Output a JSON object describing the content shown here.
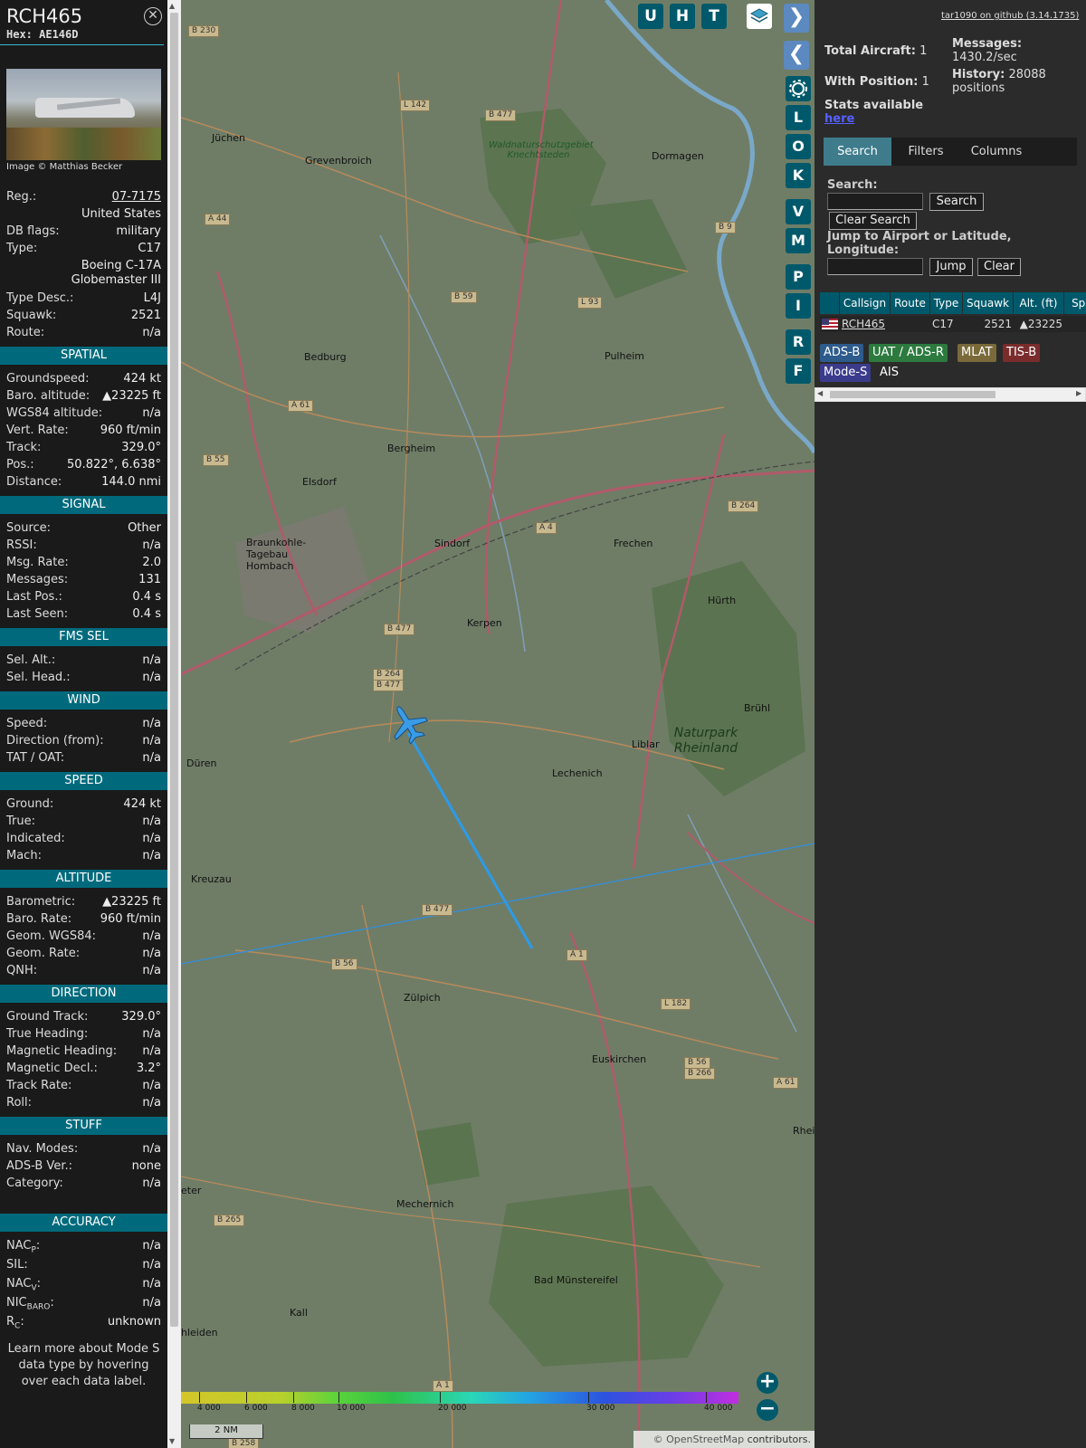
{
  "info": {
    "callsign": "RCH465",
    "hex": "Hex: AE146D",
    "image_credit": "Image © Matthias Becker",
    "top_rows": [
      {
        "k": "Reg.:",
        "v": "07-7175",
        "link": true
      },
      {
        "k": "",
        "v": "United States"
      },
      {
        "k": "DB flags:",
        "v": "military"
      },
      {
        "k": "Type:",
        "v": "C17"
      }
    ],
    "model": "Boeing C-17A Globemaster III",
    "rows2": [
      {
        "k": "Type Desc.:",
        "v": "L4J"
      },
      {
        "k": "Squawk:",
        "v": "2521"
      },
      {
        "k": "Route:",
        "v": "n/a"
      }
    ],
    "sections": [
      {
        "title": "SPATIAL",
        "rows": [
          {
            "k": "Groundspeed:",
            "v": "424 kt"
          },
          {
            "k": "Baro. altitude:",
            "v": "▲23225 ft"
          },
          {
            "k": "WGS84 altitude:",
            "v": "n/a"
          },
          {
            "k": "Vert. Rate:",
            "v": "960 ft/min"
          },
          {
            "k": "Track:",
            "v": "329.0°"
          },
          {
            "k": "Pos.:",
            "v": "50.822°, 6.638°"
          },
          {
            "k": "Distance:",
            "v": "144.0 nmi"
          }
        ]
      },
      {
        "title": "SIGNAL",
        "rows": [
          {
            "k": "Source:",
            "v": "Other"
          },
          {
            "k": "RSSI:",
            "v": "n/a"
          },
          {
            "k": "Msg. Rate:",
            "v": "2.0"
          },
          {
            "k": "Messages:",
            "v": "131"
          },
          {
            "k": "Last Pos.:",
            "v": "0.4 s"
          },
          {
            "k": "Last Seen:",
            "v": "0.4 s"
          }
        ]
      },
      {
        "title": "FMS SEL",
        "rows": [
          {
            "k": "Sel. Alt.:",
            "v": "n/a"
          },
          {
            "k": "Sel. Head.:",
            "v": "n/a"
          }
        ]
      },
      {
        "title": "WIND",
        "rows": [
          {
            "k": "Speed:",
            "v": "n/a"
          },
          {
            "k": "Direction (from):",
            "v": "n/a"
          },
          {
            "k": "TAT / OAT:",
            "v": "n/a"
          }
        ]
      },
      {
        "title": "SPEED",
        "rows": [
          {
            "k": "Ground:",
            "v": "424 kt"
          },
          {
            "k": "True:",
            "v": "n/a"
          },
          {
            "k": "Indicated:",
            "v": "n/a"
          },
          {
            "k": "Mach:",
            "v": "n/a"
          }
        ]
      },
      {
        "title": "ALTITUDE",
        "rows": [
          {
            "k": "Barometric:",
            "v": "▲23225 ft"
          },
          {
            "k": "Baro. Rate:",
            "v": "960 ft/min"
          },
          {
            "k": "Geom. WGS84:",
            "v": "n/a"
          },
          {
            "k": "Geom. Rate:",
            "v": "n/a"
          },
          {
            "k": "QNH:",
            "v": "n/a"
          }
        ]
      },
      {
        "title": "DIRECTION",
        "rows": [
          {
            "k": "Ground Track:",
            "v": "329.0°"
          },
          {
            "k": "True Heading:",
            "v": "n/a"
          },
          {
            "k": "Magnetic Heading:",
            "v": "n/a"
          },
          {
            "k": "Magnetic Decl.:",
            "v": "3.2°"
          },
          {
            "k": "Track Rate:",
            "v": "n/a"
          },
          {
            "k": "Roll:",
            "v": "n/a"
          }
        ]
      },
      {
        "title": "STUFF",
        "rows": [
          {
            "k": "Nav. Modes:",
            "v": "n/a"
          },
          {
            "k": "ADS-B Ver.:",
            "v": "none"
          },
          {
            "k": "Category:",
            "v": "n/a"
          }
        ]
      }
    ],
    "accuracy_title": "ACCURACY",
    "accuracy_rows": [
      {
        "k": "NAC",
        "sub": "P",
        "v": "n/a"
      },
      {
        "k": "SIL:",
        "sub": "",
        "v": "n/a"
      },
      {
        "k": "NAC",
        "sub": "V",
        "v": "n/a"
      },
      {
        "k": "NIC",
        "sub": "BARO",
        "v": "n/a"
      },
      {
        "k": "R",
        "sub": "C",
        "v": "unknown"
      }
    ],
    "footer": "Learn more about Mode S data type by hovering over each data label."
  },
  "map": {
    "top_buttons": [
      "U",
      "H",
      "T"
    ],
    "side_buttons": [
      "L",
      "O",
      "K",
      "V",
      "M",
      "P",
      "I",
      "R",
      "F"
    ],
    "altitude_scale": [
      "4 000",
      "6 000",
      "8 000",
      "10 000",
      "20 000",
      "30 000",
      "40 000"
    ],
    "scale_label": "2 NM",
    "attribution_link": "© OpenStreetMap",
    "attribution_rest": " contributors.",
    "places": [
      "Jüchen",
      "Grevenbroich",
      "Dormagen",
      "Bedburg",
      "Pulheim",
      "Bergheim",
      "Elsdorf",
      "Sindorf",
      "Frechen",
      "Kerpen",
      "Hürth",
      "Düren",
      "Liblar",
      "Lechenich",
      "Brühl",
      "Kreuzau",
      "Zülpich",
      "Euskirchen",
      "Mechernich",
      "Bad Münstereifel",
      "Kall",
      "hleiden",
      "eter",
      "Rhei"
    ],
    "natur": "Naturpark Rheinland",
    "braunkohle": "Braunkohle-Tagebau Hombach",
    "wald": "Waldnaturschutzgebiet Knechtsteden",
    "roads": [
      "B 230",
      "L 142",
      "B 477",
      "A 44",
      "B 59",
      "L 93",
      "B 9",
      "A 61",
      "B 55",
      "A 4",
      "B 264",
      "B 477",
      "B 264",
      "B 477",
      "B 477",
      "B 56",
      "A 1",
      "L 182",
      "B 56",
      "B 266",
      "A 61",
      "B 265",
      "B 258",
      "A 1"
    ]
  },
  "right": {
    "github": "tar1090 on github (3.14.1735)",
    "total_aircraft_label": "Total Aircraft:",
    "total_aircraft": "1",
    "with_position_label": "With Position:",
    "with_position": "1",
    "stats_label": "Stats available",
    "stats_link": "here",
    "messages_label": "Messages:",
    "messages_value": "1430.2/sec",
    "history_label": "History:",
    "history_value": "28088 positions",
    "tabs": [
      "Search",
      "Filters",
      "Columns"
    ],
    "search_label": "Search:",
    "search_btn": "Search",
    "clear_search_btn": "Clear Search",
    "jump_label": "Jump to Airport or Latitude, Longitude:",
    "jump_btn": "Jump",
    "clear_btn": "Clear",
    "columns": [
      "Callsign",
      "Route",
      "Type",
      "Squawk",
      "Alt. (ft)",
      "Spd"
    ],
    "row": {
      "callsign": "RCH465",
      "type": "C17",
      "squawk": "2521",
      "alt": "▲23225"
    },
    "legend": [
      {
        "label": "ADS-B",
        "color": "#2d5b8c"
      },
      {
        "label": "UAT / ADS-R",
        "color": "#2d7a3f"
      },
      {
        "label": "MLAT",
        "color": "#7a6a3a"
      },
      {
        "label": "TIS-B",
        "color": "#7a2c2c"
      },
      {
        "label": "Mode-S",
        "color": "#3b3b8c"
      },
      {
        "label": "AIS",
        "color": "#2b2b2b"
      }
    ]
  }
}
